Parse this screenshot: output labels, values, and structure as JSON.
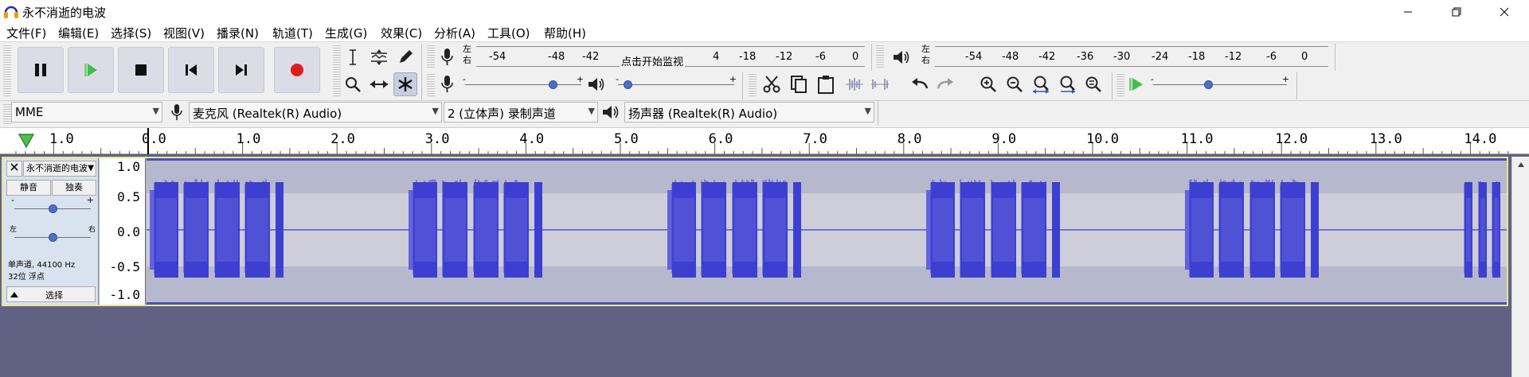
{
  "window": {
    "title": "永不消逝的电波"
  },
  "menu": [
    {
      "label": "文件(F)",
      "name": "menu-file"
    },
    {
      "label": "编辑(E)",
      "name": "menu-edit"
    },
    {
      "label": "选择(S)",
      "name": "menu-select"
    },
    {
      "label": "视图(V)",
      "name": "menu-view"
    },
    {
      "label": "播录(N)",
      "name": "menu-transport"
    },
    {
      "label": "轨道(T)",
      "name": "menu-tracks"
    },
    {
      "label": "生成(G)",
      "name": "menu-generate"
    },
    {
      "label": "效果(C)",
      "name": "menu-effect"
    },
    {
      "label": "分析(A)",
      "name": "menu-analyze"
    },
    {
      "label": "工具(O)",
      "name": "menu-tools"
    },
    {
      "label": "帮助(H)",
      "name": "menu-help"
    }
  ],
  "transport": [
    {
      "icon": "pause-icon",
      "name": "pause-button"
    },
    {
      "icon": "play-icon",
      "name": "play-button"
    },
    {
      "icon": "stop-icon",
      "name": "stop-button"
    },
    {
      "icon": "skip-to-start-icon",
      "name": "skip-to-start-button"
    },
    {
      "icon": "skip-to-end-icon",
      "name": "skip-to-end-button"
    },
    {
      "icon": "record-icon",
      "name": "record-button"
    }
  ],
  "colors": {
    "record": "#e01c1c",
    "play": "#3fbf4d",
    "waveform": "#3d3fd1",
    "waveform_light": "#6264dc",
    "track_background": "#b6b8cd",
    "workspace": "#616283",
    "track_selected_border": "#e6e78f"
  },
  "recording_meter": {
    "left_label": "左",
    "right_label": "右",
    "scale": [
      "-54",
      "-48",
      "-42",
      "-18",
      "-12",
      "-6",
      "0"
    ],
    "message": "点击开始监视",
    "message_trailing": "4"
  },
  "playback_meter": {
    "left_label": "左",
    "right_label": "右",
    "scale": [
      "-54",
      "-48",
      "-42",
      "-36",
      "-30",
      "-24",
      "-18",
      "-12",
      "-6",
      "0"
    ]
  },
  "mixer": {
    "recording_volume": 0.78,
    "playback_volume": 0.05,
    "play_at_speed": 0.41,
    "minus": "-",
    "plus": "+"
  },
  "device_toolbar": {
    "host": "MME",
    "recording_device": "麦克风 (Realtek(R) Audio)",
    "channels": "2 (立体声) 录制声道",
    "playback_device": "扬声器 (Realtek(R) Audio)"
  },
  "ruler": {
    "pre_label": "1.0",
    "labels": [
      "0.0",
      "1.0",
      "2.0",
      "3.0",
      "4.0",
      "5.0",
      "6.0",
      "7.0",
      "8.0",
      "9.0",
      "10.0",
      "11.0",
      "12.0",
      "13.0",
      "14.0"
    ]
  },
  "track": {
    "name": "永不消逝的电波",
    "mute_label": "静音",
    "solo_label": "独奏",
    "gain": 0.5,
    "pan": 0.5,
    "gain_minus": "-",
    "gain_plus": "+",
    "pan_left": "左",
    "pan_right": "右",
    "info_line1": "单声道, 44100 Hz",
    "info_line2": "32位 浮点",
    "select_label": "选择",
    "vertical_scale": [
      "1.0",
      "0.5",
      "0.0",
      "-0.5",
      "-1.0"
    ]
  }
}
